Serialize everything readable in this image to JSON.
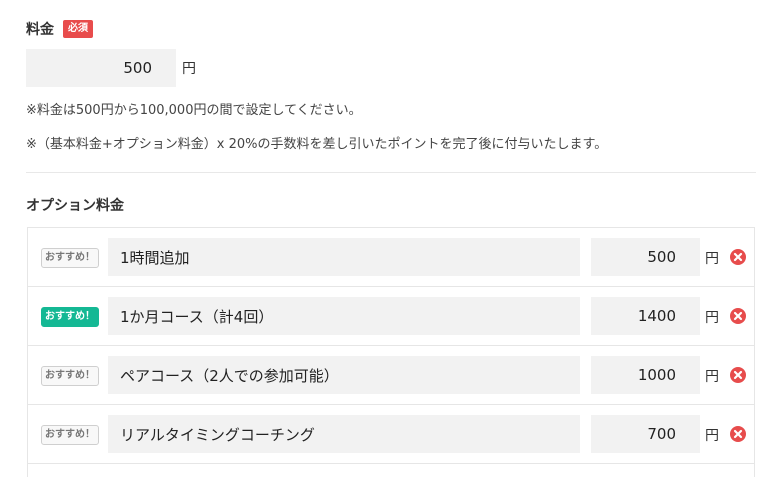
{
  "fee": {
    "label": "料金",
    "required_badge": "必須",
    "value": "500",
    "unit": "円",
    "note_range": "※料金は500円から100,000円の間で設定してください。",
    "note_commission": "※（基本料金+オプション料金）x 20%の手数料を差し引いたポイントを完了後に付与いたします。"
  },
  "options": {
    "title": "オプション料金",
    "items": [
      {
        "badge": "おすすめ！",
        "recommended": false,
        "name": "1時間追加",
        "price": "500",
        "unit": "円"
      },
      {
        "badge": "おすすめ！",
        "recommended": true,
        "name": "1か月コース（計4回）",
        "price": "1400",
        "unit": "円"
      },
      {
        "badge": "おすすめ！",
        "recommended": false,
        "name": "ペアコース（2人での参加可能）",
        "price": "1000",
        "unit": "円"
      },
      {
        "badge": "おすすめ！",
        "recommended": false,
        "name": "リアルタイミングコーチング",
        "price": "700",
        "unit": "円"
      }
    ]
  },
  "colors": {
    "required": "#e84c4c",
    "recommended": "#14b894",
    "delete": "#e74c4c",
    "input_bg": "#f2f2f2"
  },
  "icons": {
    "delete": "close-circle-icon"
  }
}
